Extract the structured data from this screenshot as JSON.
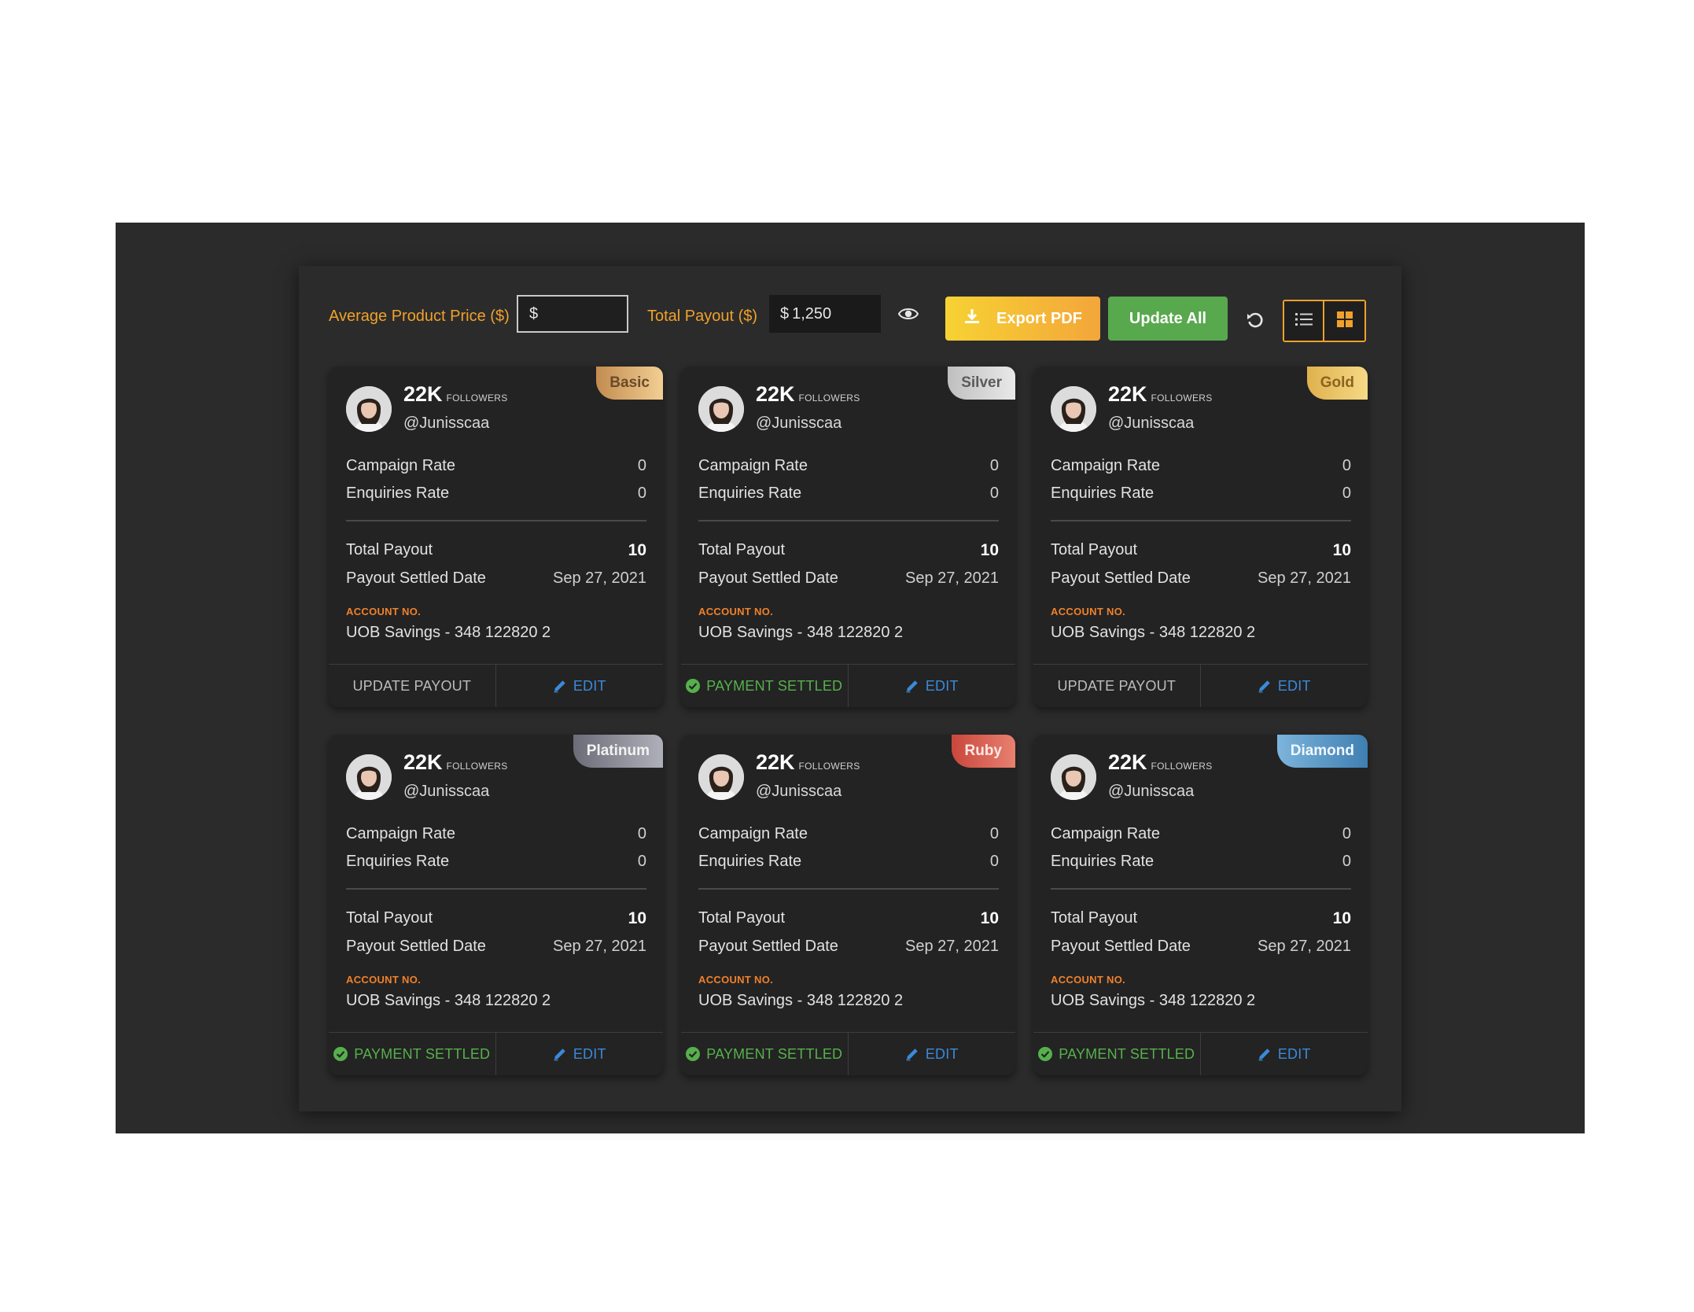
{
  "toolbar": {
    "avg_price_label": "Average Product Price ($)",
    "avg_price_prefix": "$",
    "avg_price_value": "",
    "total_payout_label": "Total Payout ($)",
    "total_payout_prefix": "$",
    "total_payout_value": "1,250",
    "eye_icon": "eye-icon",
    "export_label": "Export PDF",
    "update_all_label": "Update All",
    "refresh_icon": "refresh-icon",
    "view_options": [
      "list",
      "grid"
    ],
    "active_view": "grid"
  },
  "colors": {
    "accent": "#f0a12b",
    "settled": "#56b04c",
    "edit": "#3b8ad8",
    "background": "#2b2b2b",
    "card": "#232323"
  },
  "card_labels": {
    "followers": "FOLLOWERS",
    "campaign_rate": "Campaign Rate",
    "enquiries_rate": "Enquiries Rate",
    "total_payout": "Total Payout",
    "settled_date": "Payout Settled Date",
    "account_no": "ACCOUNT NO.",
    "update_payout": "UPDATE PAYOUT",
    "payment_settled": "PAYMENT SETTLED",
    "edit": "EDIT"
  },
  "cards": [
    {
      "tier": "Basic",
      "followers": "22K",
      "handle": "@Junisscaa",
      "campaign_rate": "0",
      "enquiries_rate": "0",
      "total_payout": "10",
      "settled_date": "Sep 27, 2021",
      "account": "UOB Savings - 348 122820 2",
      "status": "UPDATE PAYOUT",
      "edit": "EDIT"
    },
    {
      "tier": "Silver",
      "followers": "22K",
      "handle": "@Junisscaa",
      "campaign_rate": "0",
      "enquiries_rate": "0",
      "total_payout": "10",
      "settled_date": "Sep 27, 2021",
      "account": "UOB Savings - 348 122820 2",
      "status": "PAYMENT SETTLED",
      "edit": "EDIT"
    },
    {
      "tier": "Gold",
      "followers": "22K",
      "handle": "@Junisscaa",
      "campaign_rate": "0",
      "enquiries_rate": "0",
      "total_payout": "10",
      "settled_date": "Sep 27, 2021",
      "account": "UOB Savings - 348 122820 2",
      "status": "UPDATE PAYOUT",
      "edit": "EDIT"
    },
    {
      "tier": "Platinum",
      "followers": "22K",
      "handle": "@Junisscaa",
      "campaign_rate": "0",
      "enquiries_rate": "0",
      "total_payout": "10",
      "settled_date": "Sep 27, 2021",
      "account": "UOB Savings - 348 122820 2",
      "status": "PAYMENT SETTLED",
      "edit": "EDIT"
    },
    {
      "tier": "Ruby",
      "followers": "22K",
      "handle": "@Junisscaa",
      "campaign_rate": "0",
      "enquiries_rate": "0",
      "total_payout": "10",
      "settled_date": "Sep 27, 2021",
      "account": "UOB Savings - 348 122820 2",
      "status": "PAYMENT SETTLED",
      "edit": "EDIT"
    },
    {
      "tier": "Diamond",
      "followers": "22K",
      "handle": "@Junisscaa",
      "campaign_rate": "0",
      "enquiries_rate": "0",
      "total_payout": "10",
      "settled_date": "Sep 27, 2021",
      "account": "UOB Savings - 348 122820 2",
      "status": "PAYMENT SETTLED",
      "edit": "EDIT"
    }
  ]
}
